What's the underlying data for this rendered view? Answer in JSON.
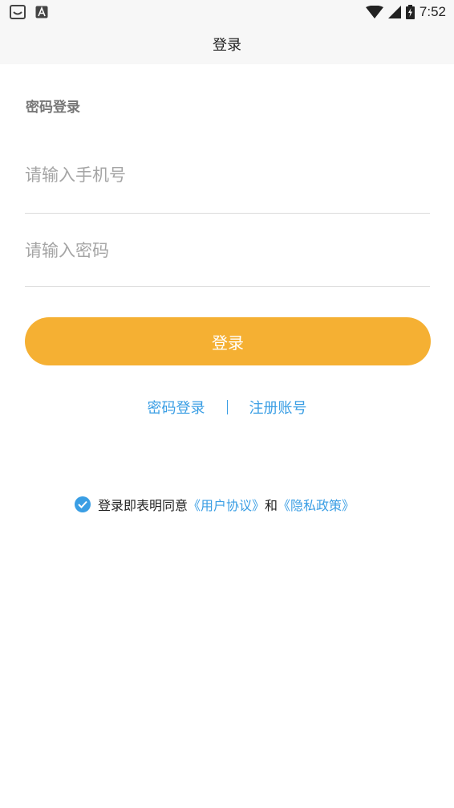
{
  "status_bar": {
    "time": "7:52",
    "left_icons": [
      "notification-tray-icon",
      "app-a-icon"
    ],
    "right_icons": [
      "wifi-icon",
      "cell-signal-icon",
      "battery-charging-icon"
    ]
  },
  "header": {
    "title": "登录"
  },
  "form": {
    "section_title": "密码登录",
    "phone_placeholder": "请输入手机号",
    "password_placeholder": "请输入密码",
    "login_button": "登录"
  },
  "links": {
    "password_login": "密码登录",
    "register": "注册账号"
  },
  "agreement": {
    "checked": true,
    "prefix": "登录即表明同意",
    "user_agreement": "《用户协议》",
    "conjunction": "和",
    "privacy_policy": "《隐私政策》"
  },
  "colors": {
    "accent": "#f5b033",
    "link": "#3a9ee4",
    "background": "#ffffff",
    "header_bg": "#f7f7f7"
  }
}
